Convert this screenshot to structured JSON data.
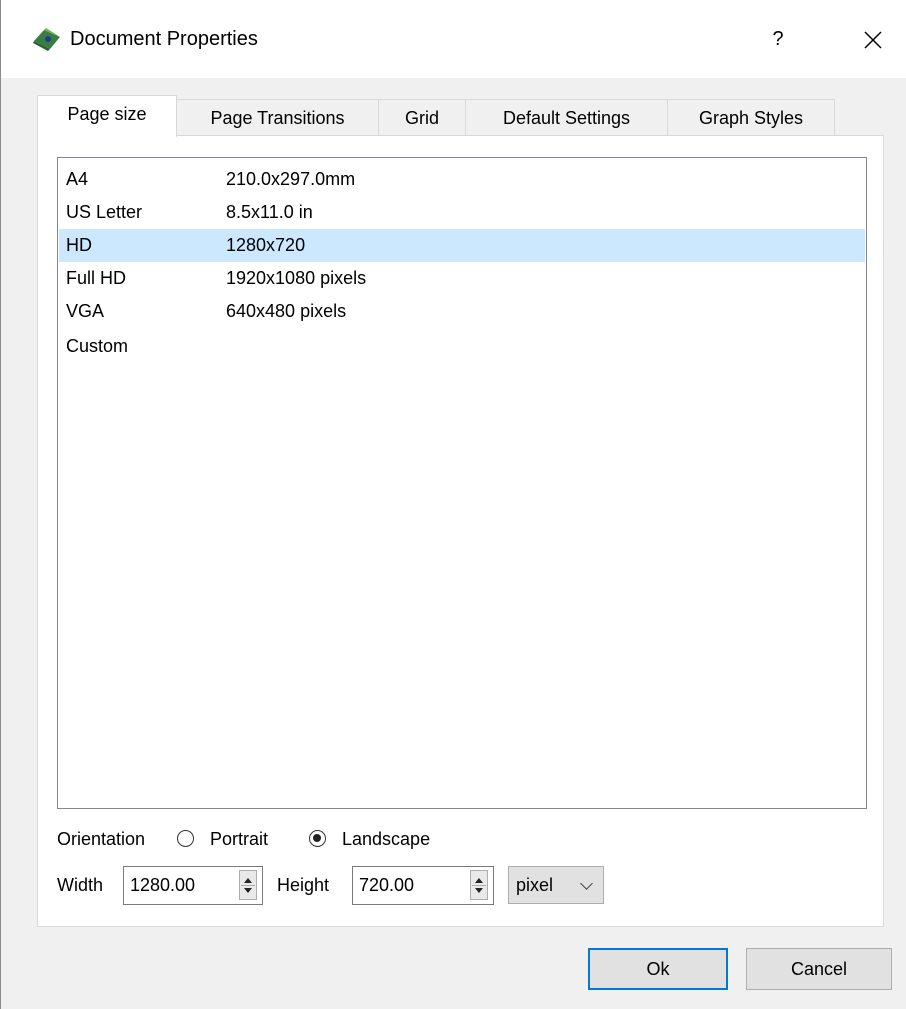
{
  "window": {
    "title": "Document Properties",
    "help_label": "?"
  },
  "tabs": [
    {
      "label": "Page size",
      "active": true
    },
    {
      "label": "Page Transitions",
      "active": false
    },
    {
      "label": "Grid",
      "active": false
    },
    {
      "label": "Default Settings",
      "active": false
    },
    {
      "label": "Graph Styles",
      "active": false
    }
  ],
  "page_sizes": [
    {
      "name": "A4",
      "size": "210.0x297.0mm",
      "selected": false
    },
    {
      "name": "US Letter",
      "size": "8.5x11.0 in",
      "selected": false
    },
    {
      "name": "HD",
      "size": "1280x720",
      "selected": true
    },
    {
      "name": "Full HD",
      "size": "1920x1080 pixels",
      "selected": false
    },
    {
      "name": "VGA",
      "size": "640x480 pixels",
      "selected": false
    },
    {
      "name": "Custom",
      "size": "",
      "selected": false
    }
  ],
  "orientation": {
    "label": "Orientation",
    "portrait_label": "Portrait",
    "landscape_label": "Landscape",
    "selected": "Landscape"
  },
  "dimensions": {
    "width_label": "Width",
    "width_value": "1280.00",
    "height_label": "Height",
    "height_value": "720.00",
    "unit": "pixel"
  },
  "buttons": {
    "ok": "Ok",
    "cancel": "Cancel"
  },
  "colors": {
    "selection": "#cce8ff",
    "default_button_border": "#0078d7"
  }
}
